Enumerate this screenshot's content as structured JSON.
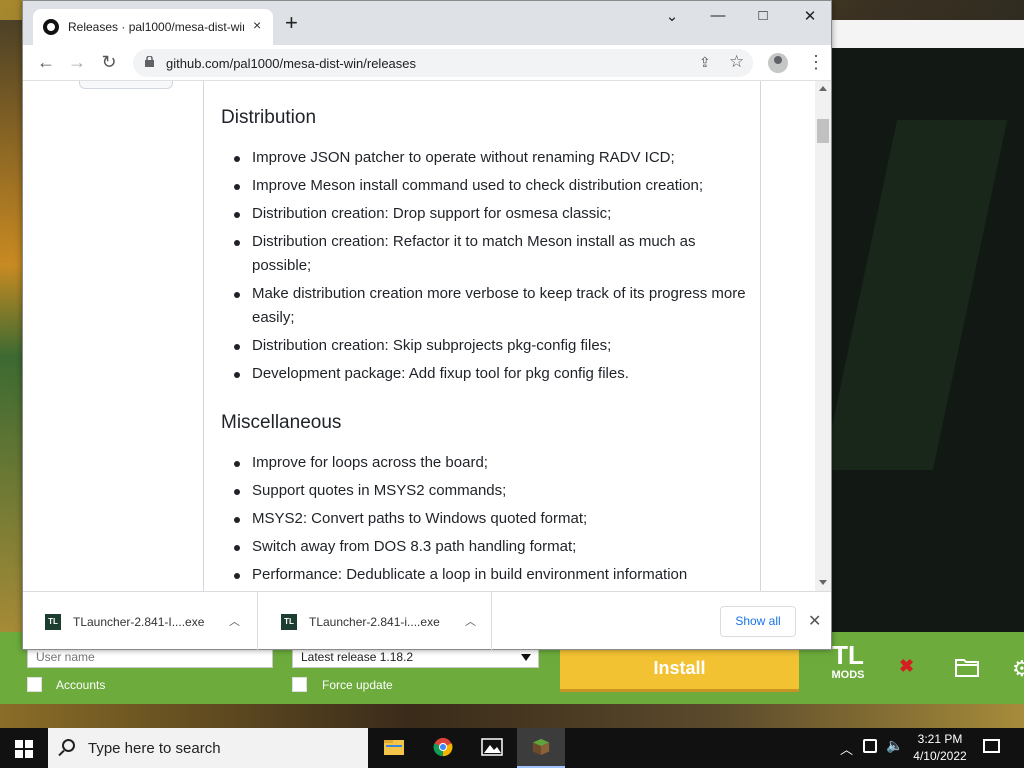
{
  "browser": {
    "tab_title": "Releases · pal1000/mesa-dist-win",
    "url": "github.com/pal1000/mesa-dist-win/releases",
    "new_tab": "+",
    "tab_close": "×",
    "controls": {
      "dropdown": "⌄",
      "minimize": "—",
      "maximize": "□",
      "close": "✕"
    }
  },
  "article": {
    "sections": [
      {
        "heading": "Distribution",
        "items": [
          "Improve JSON patcher to operate without renaming RADV ICD;",
          "Improve Meson install command used to check distribution creation;",
          "Distribution creation: Drop support for osmesa classic;",
          "Distribution creation: Refactor it to match Meson install as much as possible;",
          "Make distribution creation more verbose to keep track of its progress more easily;",
          "Distribution creation: Skip subprojects pkg-config files;",
          "Development package: Add fixup tool for pkg config files."
        ]
      },
      {
        "heading": "Miscellaneous",
        "items": [
          "Improve for loops across the board;",
          "Support quotes in MSYS2 commands;",
          "MSYS2: Convert paths to Windows quoted format;",
          "Switch away from DOS 8.3 path handling format;",
          "Performance: Dedublicate a loop in build environment information"
        ]
      }
    ]
  },
  "downloads": {
    "items": [
      {
        "icon_text": "TL",
        "name": "TLauncher-2.841-I....exe"
      },
      {
        "icon_text": "TL",
        "name": "TLauncher-2.841-i....exe"
      }
    ],
    "show_all": "Show all",
    "close": "✕"
  },
  "tlauncher": {
    "username_placeholder": "User name",
    "version": "Latest release 1.18.2",
    "accounts_label": "Accounts",
    "force_update_label": "Force update",
    "install_label": "Install",
    "logo_top": "TL",
    "logo_bottom": "MODS",
    "accent": "#6cab3c",
    "install_color": "#f2c233"
  },
  "taskbar": {
    "search_placeholder": "Type here to search",
    "time": "3:21 PM",
    "date": "4/10/2022",
    "apps": [
      "file-explorer",
      "chrome",
      "photos",
      "minecraft"
    ]
  }
}
